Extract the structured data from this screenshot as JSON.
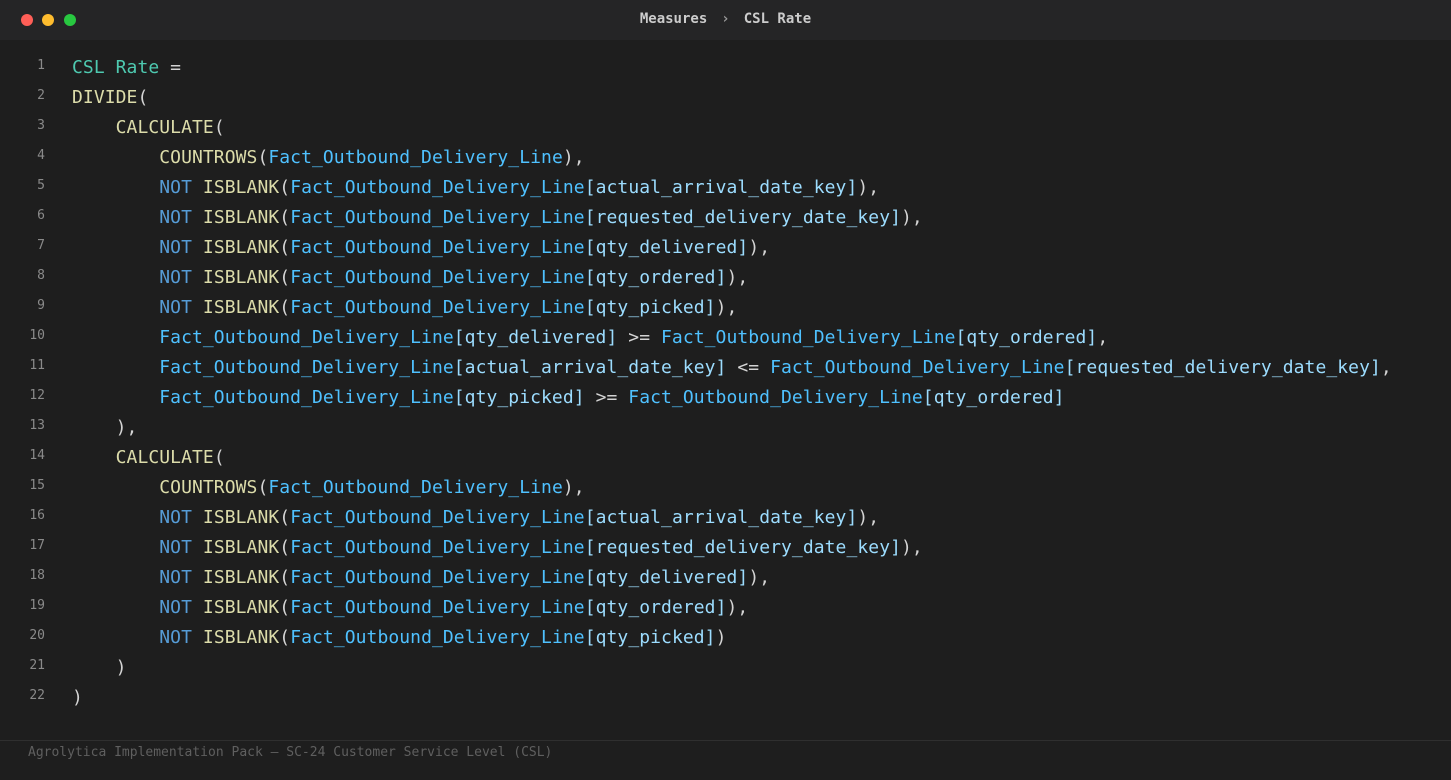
{
  "window": {
    "breadcrumb": [
      "Measures",
      "CSL Rate"
    ],
    "breadcrumb_separator": "›",
    "controls": [
      "close-button",
      "minimize-button",
      "maximize-button"
    ]
  },
  "colors": {
    "measure": "#4ec9b0",
    "function": "#dcdcaa",
    "keyword": "#569cd6",
    "table": "#4fc1ff",
    "column": "#9cdcfe",
    "punctuation": "#d4d4d4"
  },
  "editor": {
    "language": "DAX",
    "lines": [
      {
        "n": "1",
        "tokens": [
          [
            "measure",
            "CSL Rate"
          ],
          [
            "punct",
            " ="
          ]
        ]
      },
      {
        "n": "2",
        "tokens": [
          [
            "fn",
            "DIVIDE"
          ],
          [
            "punct",
            "("
          ]
        ]
      },
      {
        "n": "3",
        "tokens": [
          [
            "punct",
            "    "
          ],
          [
            "fn",
            "CALCULATE"
          ],
          [
            "punct",
            "("
          ]
        ]
      },
      {
        "n": "4",
        "tokens": [
          [
            "punct",
            "        "
          ],
          [
            "fn",
            "COUNTROWS"
          ],
          [
            "punct",
            "("
          ],
          [
            "tbl",
            "Fact_Outbound_Delivery_Line"
          ],
          [
            "punct",
            "),"
          ]
        ]
      },
      {
        "n": "5",
        "tokens": [
          [
            "punct",
            "        "
          ],
          [
            "kw",
            "NOT"
          ],
          [
            "punct",
            " "
          ],
          [
            "fn",
            "ISBLANK"
          ],
          [
            "punct",
            "("
          ],
          [
            "tbl",
            "Fact_Outbound_Delivery_Line"
          ],
          [
            "col",
            "[actual_arrival_date_key]"
          ],
          [
            "punct",
            "),"
          ]
        ]
      },
      {
        "n": "6",
        "tokens": [
          [
            "punct",
            "        "
          ],
          [
            "kw",
            "NOT"
          ],
          [
            "punct",
            " "
          ],
          [
            "fn",
            "ISBLANK"
          ],
          [
            "punct",
            "("
          ],
          [
            "tbl",
            "Fact_Outbound_Delivery_Line"
          ],
          [
            "col",
            "[requested_delivery_date_key]"
          ],
          [
            "punct",
            "),"
          ]
        ]
      },
      {
        "n": "7",
        "tokens": [
          [
            "punct",
            "        "
          ],
          [
            "kw",
            "NOT"
          ],
          [
            "punct",
            " "
          ],
          [
            "fn",
            "ISBLANK"
          ],
          [
            "punct",
            "("
          ],
          [
            "tbl",
            "Fact_Outbound_Delivery_Line"
          ],
          [
            "col",
            "[qty_delivered]"
          ],
          [
            "punct",
            "),"
          ]
        ]
      },
      {
        "n": "8",
        "tokens": [
          [
            "punct",
            "        "
          ],
          [
            "kw",
            "NOT"
          ],
          [
            "punct",
            " "
          ],
          [
            "fn",
            "ISBLANK"
          ],
          [
            "punct",
            "("
          ],
          [
            "tbl",
            "Fact_Outbound_Delivery_Line"
          ],
          [
            "col",
            "[qty_ordered]"
          ],
          [
            "punct",
            "),"
          ]
        ]
      },
      {
        "n": "9",
        "tokens": [
          [
            "punct",
            "        "
          ],
          [
            "kw",
            "NOT"
          ],
          [
            "punct",
            " "
          ],
          [
            "fn",
            "ISBLANK"
          ],
          [
            "punct",
            "("
          ],
          [
            "tbl",
            "Fact_Outbound_Delivery_Line"
          ],
          [
            "col",
            "[qty_picked]"
          ],
          [
            "punct",
            "),"
          ]
        ]
      },
      {
        "n": "10",
        "tokens": [
          [
            "punct",
            "        "
          ],
          [
            "tbl",
            "Fact_Outbound_Delivery_Line"
          ],
          [
            "col",
            "[qty_delivered]"
          ],
          [
            "punct",
            " >= "
          ],
          [
            "tbl",
            "Fact_Outbound_Delivery_Line"
          ],
          [
            "col",
            "[qty_ordered]"
          ],
          [
            "punct",
            ","
          ]
        ]
      },
      {
        "n": "11",
        "tokens": [
          [
            "punct",
            "        "
          ],
          [
            "tbl",
            "Fact_Outbound_Delivery_Line"
          ],
          [
            "col",
            "[actual_arrival_date_key]"
          ],
          [
            "punct",
            " <= "
          ],
          [
            "tbl",
            "Fact_Outbound_Delivery_Line"
          ],
          [
            "col",
            "[requested_delivery_date_key]"
          ],
          [
            "punct",
            ","
          ]
        ]
      },
      {
        "n": "12",
        "tokens": [
          [
            "punct",
            "        "
          ],
          [
            "tbl",
            "Fact_Outbound_Delivery_Line"
          ],
          [
            "col",
            "[qty_picked]"
          ],
          [
            "punct",
            " >= "
          ],
          [
            "tbl",
            "Fact_Outbound_Delivery_Line"
          ],
          [
            "col",
            "[qty_ordered]"
          ]
        ]
      },
      {
        "n": "13",
        "tokens": [
          [
            "punct",
            "    ),"
          ]
        ]
      },
      {
        "n": "14",
        "tokens": [
          [
            "punct",
            "    "
          ],
          [
            "fn",
            "CALCULATE"
          ],
          [
            "punct",
            "("
          ]
        ]
      },
      {
        "n": "15",
        "tokens": [
          [
            "punct",
            "        "
          ],
          [
            "fn",
            "COUNTROWS"
          ],
          [
            "punct",
            "("
          ],
          [
            "tbl",
            "Fact_Outbound_Delivery_Line"
          ],
          [
            "punct",
            "),"
          ]
        ]
      },
      {
        "n": "16",
        "tokens": [
          [
            "punct",
            "        "
          ],
          [
            "kw",
            "NOT"
          ],
          [
            "punct",
            " "
          ],
          [
            "fn",
            "ISBLANK"
          ],
          [
            "punct",
            "("
          ],
          [
            "tbl",
            "Fact_Outbound_Delivery_Line"
          ],
          [
            "col",
            "[actual_arrival_date_key]"
          ],
          [
            "punct",
            "),"
          ]
        ]
      },
      {
        "n": "17",
        "tokens": [
          [
            "punct",
            "        "
          ],
          [
            "kw",
            "NOT"
          ],
          [
            "punct",
            " "
          ],
          [
            "fn",
            "ISBLANK"
          ],
          [
            "punct",
            "("
          ],
          [
            "tbl",
            "Fact_Outbound_Delivery_Line"
          ],
          [
            "col",
            "[requested_delivery_date_key]"
          ],
          [
            "punct",
            "),"
          ]
        ]
      },
      {
        "n": "18",
        "tokens": [
          [
            "punct",
            "        "
          ],
          [
            "kw",
            "NOT"
          ],
          [
            "punct",
            " "
          ],
          [
            "fn",
            "ISBLANK"
          ],
          [
            "punct",
            "("
          ],
          [
            "tbl",
            "Fact_Outbound_Delivery_Line"
          ],
          [
            "col",
            "[qty_delivered]"
          ],
          [
            "punct",
            "),"
          ]
        ]
      },
      {
        "n": "19",
        "tokens": [
          [
            "punct",
            "        "
          ],
          [
            "kw",
            "NOT"
          ],
          [
            "punct",
            " "
          ],
          [
            "fn",
            "ISBLANK"
          ],
          [
            "punct",
            "("
          ],
          [
            "tbl",
            "Fact_Outbound_Delivery_Line"
          ],
          [
            "col",
            "[qty_ordered]"
          ],
          [
            "punct",
            "),"
          ]
        ]
      },
      {
        "n": "20",
        "tokens": [
          [
            "punct",
            "        "
          ],
          [
            "kw",
            "NOT"
          ],
          [
            "punct",
            " "
          ],
          [
            "fn",
            "ISBLANK"
          ],
          [
            "punct",
            "("
          ],
          [
            "tbl",
            "Fact_Outbound_Delivery_Line"
          ],
          [
            "col",
            "[qty_picked]"
          ],
          [
            "punct",
            ")"
          ]
        ]
      },
      {
        "n": "21",
        "tokens": [
          [
            "punct",
            "    )"
          ]
        ]
      },
      {
        "n": "22",
        "tokens": [
          [
            "punct",
            ")"
          ]
        ]
      }
    ]
  },
  "footer": {
    "text": "Agrolytica Implementation Pack — SC-24 Customer Service Level (CSL)"
  }
}
